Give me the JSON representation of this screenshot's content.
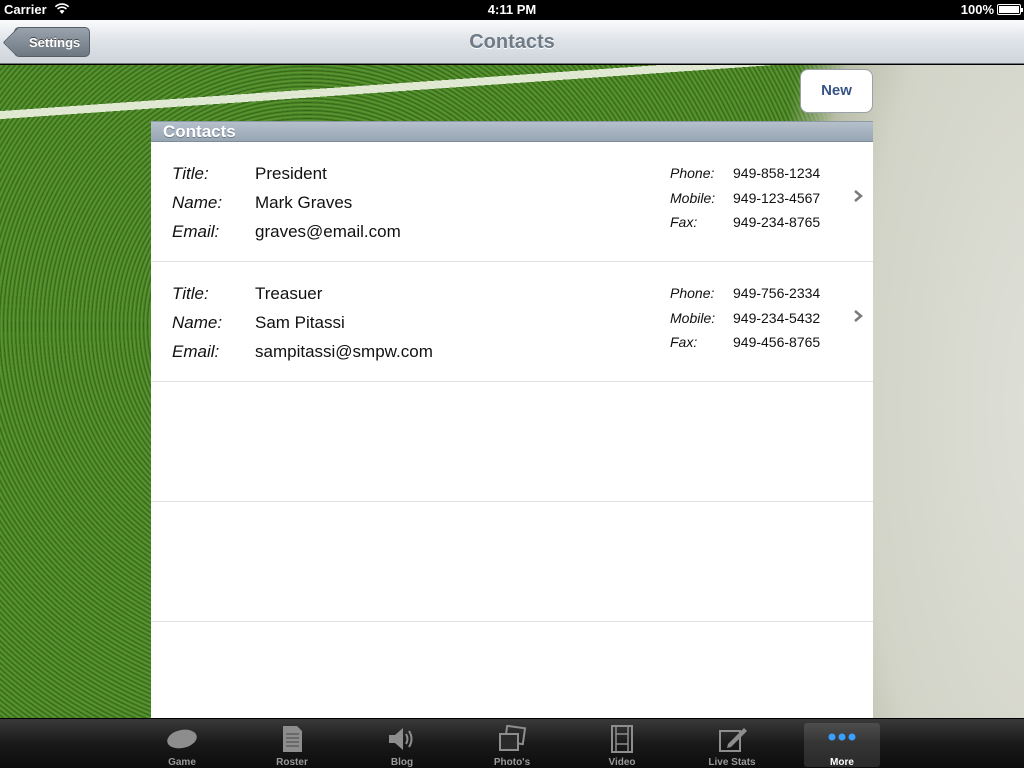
{
  "status_bar": {
    "carrier": "Carrier",
    "time": "4:11 PM",
    "battery": "100%",
    "battery_level": 1.0
  },
  "nav": {
    "title": "Contacts",
    "back_label": "Settings"
  },
  "actions": {
    "new_label": "New"
  },
  "section": {
    "header": "Contacts"
  },
  "labels": {
    "title": "Title:",
    "name": "Name:",
    "email": "Email:",
    "phone": "Phone:",
    "mobile": "Mobile:",
    "fax": "Fax:"
  },
  "contacts": [
    {
      "title": "President",
      "name": "Mark Graves",
      "email": "graves@email.com",
      "phone": "949-858-1234",
      "mobile": "949-123-4567",
      "fax": "949-234-8765"
    },
    {
      "title": "Treasuer",
      "name": "Sam Pitassi",
      "email": "sampitassi@smpw.com",
      "phone": "949-756-2334",
      "mobile": "949-234-5432",
      "fax": "949-456-8765"
    }
  ],
  "tabs": [
    {
      "label": "Game",
      "icon": "football-icon",
      "selected": false
    },
    {
      "label": "Roster",
      "icon": "document-icon",
      "selected": false
    },
    {
      "label": "Blog",
      "icon": "speaker-icon",
      "selected": false
    },
    {
      "label": "Photo's",
      "icon": "photos-icon",
      "selected": false
    },
    {
      "label": "Video",
      "icon": "film-icon",
      "selected": false
    },
    {
      "label": "Live Stats",
      "icon": "edit-icon",
      "selected": false
    },
    {
      "label": "More",
      "icon": "more-icon",
      "selected": true
    }
  ],
  "colors": {
    "accent": "#385487",
    "nav_title": "#6f7b87",
    "tab_selected": "#3aa0ff"
  }
}
